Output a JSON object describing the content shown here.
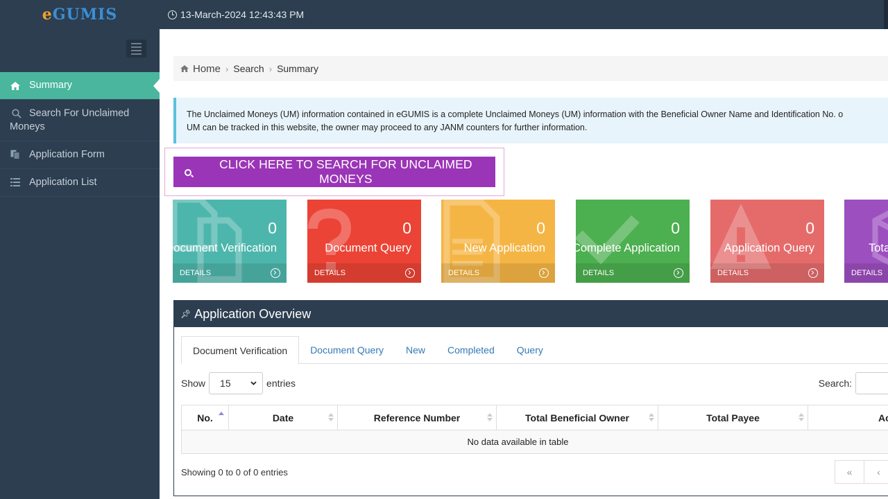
{
  "app": {
    "logo_prefix": "e",
    "logo_main": "GUMIS",
    "datetime": "13-March-2024 12:43:43 PM"
  },
  "sidebar": {
    "items": [
      {
        "label": "Summary",
        "icon": "home-icon",
        "active": true
      },
      {
        "label": "Search For Unclaimed Moneys",
        "icon": "search-icon",
        "active": false
      },
      {
        "label": "Application Form",
        "icon": "copy-icon",
        "active": false
      },
      {
        "label": "Application List",
        "icon": "list-icon",
        "active": false
      }
    ]
  },
  "breadcrumb": {
    "home": "Home",
    "search": "Search",
    "current": "Summary"
  },
  "notice": {
    "line1": "The Unclaimed Moneys (UM) information contained in eGUMIS is a complete Unclaimed Moneys (UM) information with the Beneficial Owner Name and Identification No. o",
    "line2": "UM can be tracked in this website, the owner may proceed to any JANM counters for further information."
  },
  "search_button": {
    "label": "CLICK HERE TO SEARCH FOR UNCLAIMED MONEYS"
  },
  "tiles": [
    {
      "count": "0",
      "label": "Document Verification",
      "footer": "DETAILS",
      "color": "#4db6ac",
      "icon": "documents-icon"
    },
    {
      "count": "0",
      "label": "Document Query",
      "footer": "DETAILS",
      "color": "#eb4335",
      "icon": "question-icon"
    },
    {
      "count": "0",
      "label": "New Application",
      "footer": "DETAILS",
      "color": "#f5b544",
      "icon": "file-text-icon"
    },
    {
      "count": "0",
      "label": "Complete Application",
      "footer": "DETAILS",
      "color": "#4caf50",
      "icon": "check-icon"
    },
    {
      "count": "0",
      "label": "Application Query",
      "footer": "DETAILS",
      "color": "#e56b6b",
      "icon": "warning-icon"
    },
    {
      "count": "",
      "label": "Tota",
      "footer": "DETAILS",
      "color": "#9c4fbf",
      "icon": "cube-icon"
    }
  ],
  "overview": {
    "title": "Application Overview",
    "tabs": [
      "Document Verification",
      "Document Query",
      "New",
      "Completed",
      "Query"
    ],
    "active_tab": "Document Verification",
    "show_label": "Show",
    "entries_value": "15",
    "entries_label": "entries",
    "search_label": "Search:",
    "columns": [
      "No.",
      "Date",
      "Reference Number",
      "Total Beneficial Owner",
      "Total Payee",
      "Actio"
    ],
    "empty_message": "No data available in table",
    "info": "Showing 0 to 0 of 0 entries",
    "pager": [
      "«",
      "‹"
    ]
  }
}
